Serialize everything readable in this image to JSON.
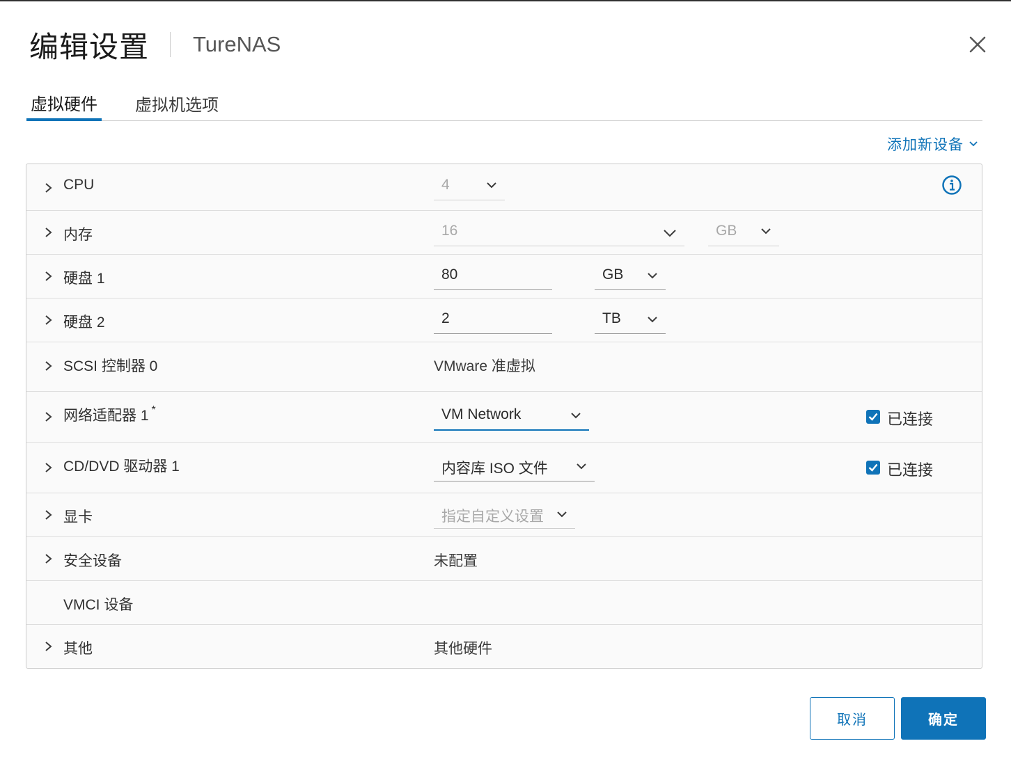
{
  "dialog": {
    "title": "编辑设置",
    "subtitle": "TureNAS"
  },
  "tabs": [
    {
      "label": "虚拟硬件",
      "active": true
    },
    {
      "label": "虚拟机选项",
      "active": false
    }
  ],
  "add_device": {
    "label": "添加新设备"
  },
  "hardware": {
    "cpu": {
      "label": "CPU",
      "value": "4"
    },
    "memory": {
      "label": "内存",
      "value": "16",
      "unit": "GB"
    },
    "disk1": {
      "label": "硬盘 1",
      "value": "80",
      "unit": "GB"
    },
    "disk2": {
      "label": "硬盘 2",
      "value": "2",
      "unit": "TB"
    },
    "scsi": {
      "label": "SCSI 控制器 0",
      "value": "VMware 准虚拟"
    },
    "network": {
      "label": "网络适配器 1",
      "required_mark": "*",
      "value": "VM Network",
      "connected_label": "已连接",
      "connected": true
    },
    "cdrom": {
      "label": "CD/DVD 驱动器 1",
      "value": "内容库 ISO 文件",
      "connected_label": "已连接",
      "connected": true
    },
    "video": {
      "label": "显卡",
      "value": "指定自定义设置"
    },
    "security": {
      "label": "安全设备",
      "value": "未配置"
    },
    "vmci": {
      "label": "VMCI 设备"
    },
    "other": {
      "label": "其他",
      "value": "其他硬件"
    }
  },
  "buttons": {
    "cancel": "取消",
    "ok": "确定"
  },
  "colors": {
    "accent": "#0f73b8",
    "panel_bg": "#fafafa",
    "border": "#cccccc"
  }
}
